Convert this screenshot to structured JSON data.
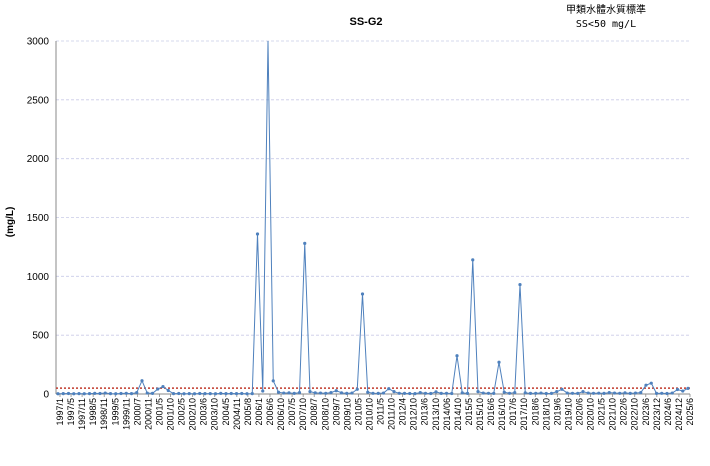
{
  "chart_data": {
    "type": "line",
    "title": "SS-G2",
    "ylabel": "(mg/L)",
    "xlabel": "",
    "ylim": [
      0,
      3000
    ],
    "yticks": [
      0,
      500,
      1000,
      1500,
      2000,
      2500,
      3000
    ],
    "grid": true,
    "annotation": {
      "line1": "甲類水體水質標準",
      "line2": "SS<50 mg/L"
    },
    "standard": {
      "value": 50,
      "color": "#c0392b"
    },
    "series_color": "#4f81bd",
    "xtick_labels": [
      "1997/1",
      "1997/5",
      "1997/11",
      "1998/5",
      "1998/11",
      "1999/5",
      "1999/11",
      "2000/7",
      "2000/11",
      "2001/5",
      "2001/10",
      "2002/5",
      "2002/10",
      "2003/6",
      "2003/10",
      "2004/5",
      "2004/11",
      "2005/8",
      "2006/1",
      "2006/6",
      "2006/10",
      "2007/5",
      "2007/10",
      "2008/7",
      "2008/10",
      "2009/7",
      "2009/10",
      "2010/5",
      "2010/10",
      "2011/5",
      "2011/10",
      "2012/4",
      "2012/10",
      "2013/6",
      "2013/10",
      "2014/06",
      "2014/10",
      "2015/5",
      "2015/10",
      "2016/6",
      "2016/10",
      "2017/6",
      "2017/10",
      "2018/6",
      "2018/10",
      "2019/6",
      "2019/10",
      "2020/6",
      "2020/10",
      "2021/5",
      "2021/10",
      "2022/6",
      "2022/10",
      "2023/6",
      "2023/12",
      "2024/6",
      "2024/12",
      "2025/6"
    ],
    "values": [
      2,
      3,
      4,
      2,
      3,
      2,
      3,
      5,
      4,
      8,
      3,
      2,
      4,
      6,
      3,
      12,
      113,
      8,
      5,
      42,
      63,
      30,
      3,
      4,
      2,
      3,
      2,
      4,
      3,
      3,
      2,
      5,
      3,
      4,
      3,
      4,
      2,
      3,
      1360,
      25,
      3100,
      112,
      15,
      8,
      10,
      5,
      12,
      1280,
      20,
      10,
      8,
      6,
      12,
      28,
      10,
      5,
      8,
      40,
      850,
      15,
      6,
      5,
      8,
      45,
      20,
      6,
      5,
      4,
      3,
      12,
      6,
      4,
      18,
      5,
      6,
      4,
      325,
      10,
      5,
      1140,
      20,
      8,
      6,
      5,
      270,
      15,
      6,
      12,
      930,
      10,
      5,
      6,
      8,
      4,
      5,
      20,
      40,
      8,
      6,
      5,
      20,
      8,
      6,
      7,
      5,
      12,
      8,
      6,
      10,
      5,
      8,
      12,
      75,
      92,
      5,
      6,
      4,
      8,
      38,
      25,
      48
    ]
  }
}
